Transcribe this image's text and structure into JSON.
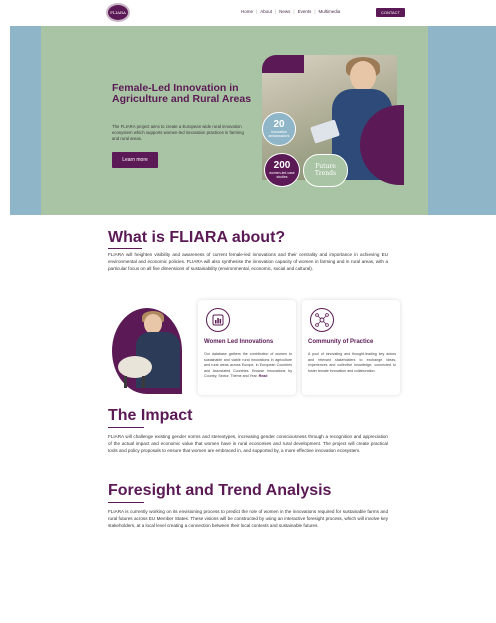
{
  "nav": {
    "logo_text": "FLIARA",
    "links": [
      "Home",
      "About",
      "News",
      "Events",
      "Multimedia"
    ],
    "contact_label": "CONTACT"
  },
  "hero": {
    "title": "Female-Led Innovation in Agriculture and Rural Areas",
    "description": "The FLIARA project aims to create a European wide rural innovation ecosystem which supports women-led innovation practices in farming and rural areas.",
    "button_label": "Learn more",
    "stats": [
      {
        "number": "20",
        "label": "innovation ambassadors"
      },
      {
        "number": "200",
        "label": "women-led case studies"
      }
    ],
    "future_label_1": "Future",
    "future_label_2": "Trends"
  },
  "about": {
    "title": "What is FLIARA about?",
    "text": "FLIARA will heighten visibility and awareness of current female-led innovations and their centrality and importance in achieving EU environmental and economic policies. FLIARA will also synthesise the innovation capacity of women in farming and in rural areas, with a particular focus on all five dimensions of sustainability (environmental, economic, social and cultural)."
  },
  "cards": [
    {
      "title": "Women Led Innovations",
      "text": "Our database gathers the contribution of women to sustainable and viable rural innovations in agriculture and rural areas across Europe, in European Countries and Associated Countries. Browse Innovations by Country, Sector, Theme and Year.",
      "more": "Read"
    },
    {
      "title": "Community of Practice",
      "text": "A pool of innovating and thought-leading key actors and relevant stakeholders to exchange ideas, experiences and collective knowledge, connected to foster female innovation and collaboration."
    }
  ],
  "impact": {
    "title": "The Impact",
    "text": "FLIARA will challenge existing gender norms and stereotypes, increasing gender consciousness through a recognition and appreciation of the actual impact and economic value that women have in rural economies and rural development. The project will create practical tools and policy proposals to ensure that women are embraced in, and supported by, a more effective innovation ecosystem."
  },
  "foresight": {
    "title": "Foresight and Trend Analysis",
    "text": "FLIARA is currently working on its envisioning process to predict the role of women in the innovations required for sustainable farms and rural futures across EU Member States. These visions will be constructed by using an interactive foresight process, which will involve key stakeholders, at a local level creating a connection between their local contexts and sustainable futures."
  },
  "colors": {
    "brand": "#5b1a55",
    "hero_bg": "#8fb6c8",
    "hero_panel": "#a9c4a4"
  }
}
